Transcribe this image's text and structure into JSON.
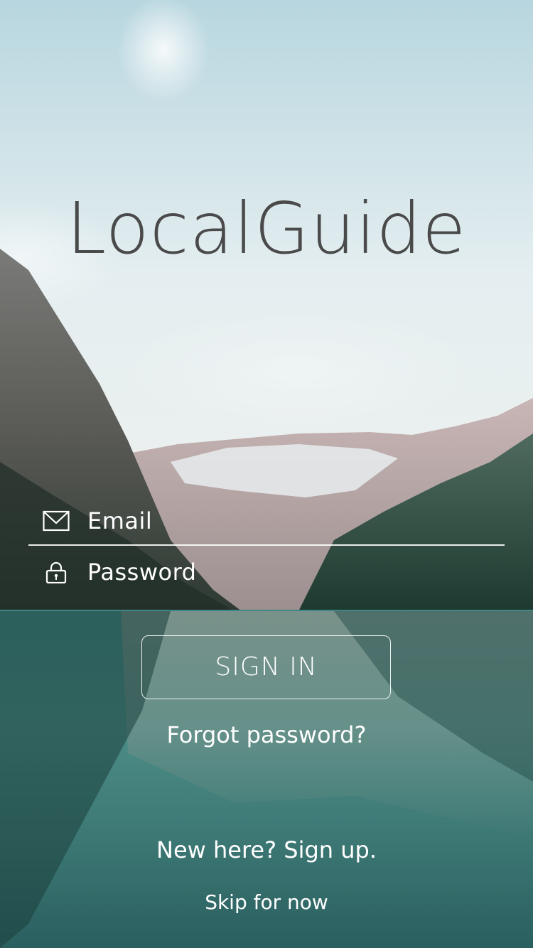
{
  "app": {
    "title": "LocalGuide"
  },
  "form": {
    "email_placeholder": "Email",
    "password_placeholder": "Password",
    "email_icon": "envelope-icon",
    "password_icon": "lock-icon"
  },
  "actions": {
    "sign_in_label": "SIGN IN",
    "forgot_password_label": "Forgot password?",
    "sign_up_label": "New here? Sign up.",
    "skip_label": "Skip for now"
  },
  "colors": {
    "title_text": "#4a4a4a",
    "foreground": "#ffffff",
    "sky_top": "#b9d7df",
    "lake": "#2f6e6c"
  }
}
